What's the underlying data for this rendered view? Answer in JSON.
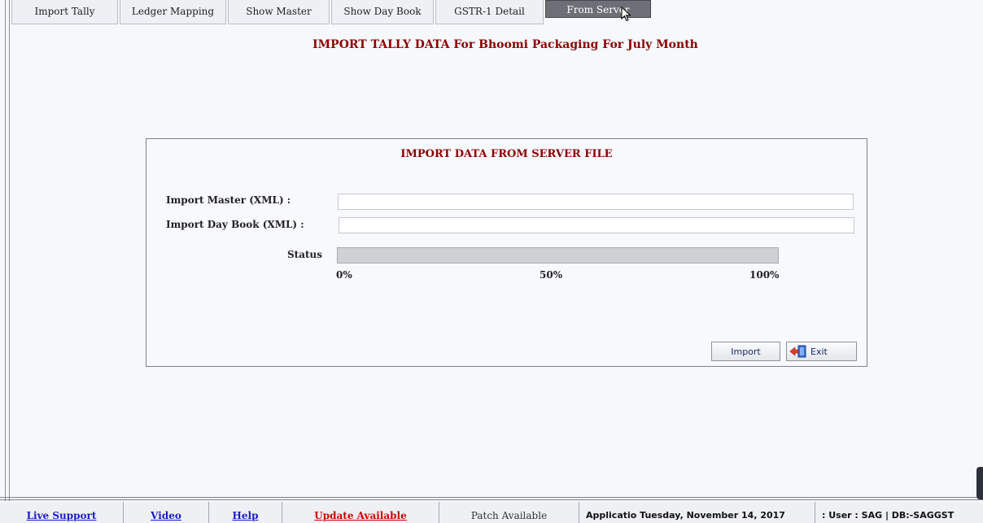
{
  "tabs": [
    {
      "label": "Import Tally"
    },
    {
      "label": "Ledger Mapping"
    },
    {
      "label": "Show Master"
    },
    {
      "label": "Show Day Book"
    },
    {
      "label": "GSTR-1 Detail"
    },
    {
      "label": "From Server",
      "active": true
    }
  ],
  "page_title": "IMPORT TALLY DATA For Bhoomi Packaging For July Month",
  "panel": {
    "title": "IMPORT DATA  FROM SERVER FILE",
    "import_master_label": "Import Master (XML)  :",
    "import_master_value": "",
    "import_daybook_label": "Import Day Book (XML)  :",
    "import_daybook_value": "",
    "status_label": "Status",
    "progress_percent": 0,
    "ticks": [
      "0%",
      "50%",
      "100%"
    ],
    "import_button": "Import",
    "exit_button": "Exit"
  },
  "statusbar": {
    "live_support": "Live Support",
    "video": "Video",
    "help": "Help",
    "update_available": "Update Available",
    "patch_available": "Patch Available",
    "app_date": "Applicatio Tuesday, November 14, 2017",
    "user_db": ": User : SAG  |  DB:-SAGGST"
  },
  "icons": {
    "cursor": "mouse-pointer-icon",
    "exit": "exit-door-icon"
  }
}
